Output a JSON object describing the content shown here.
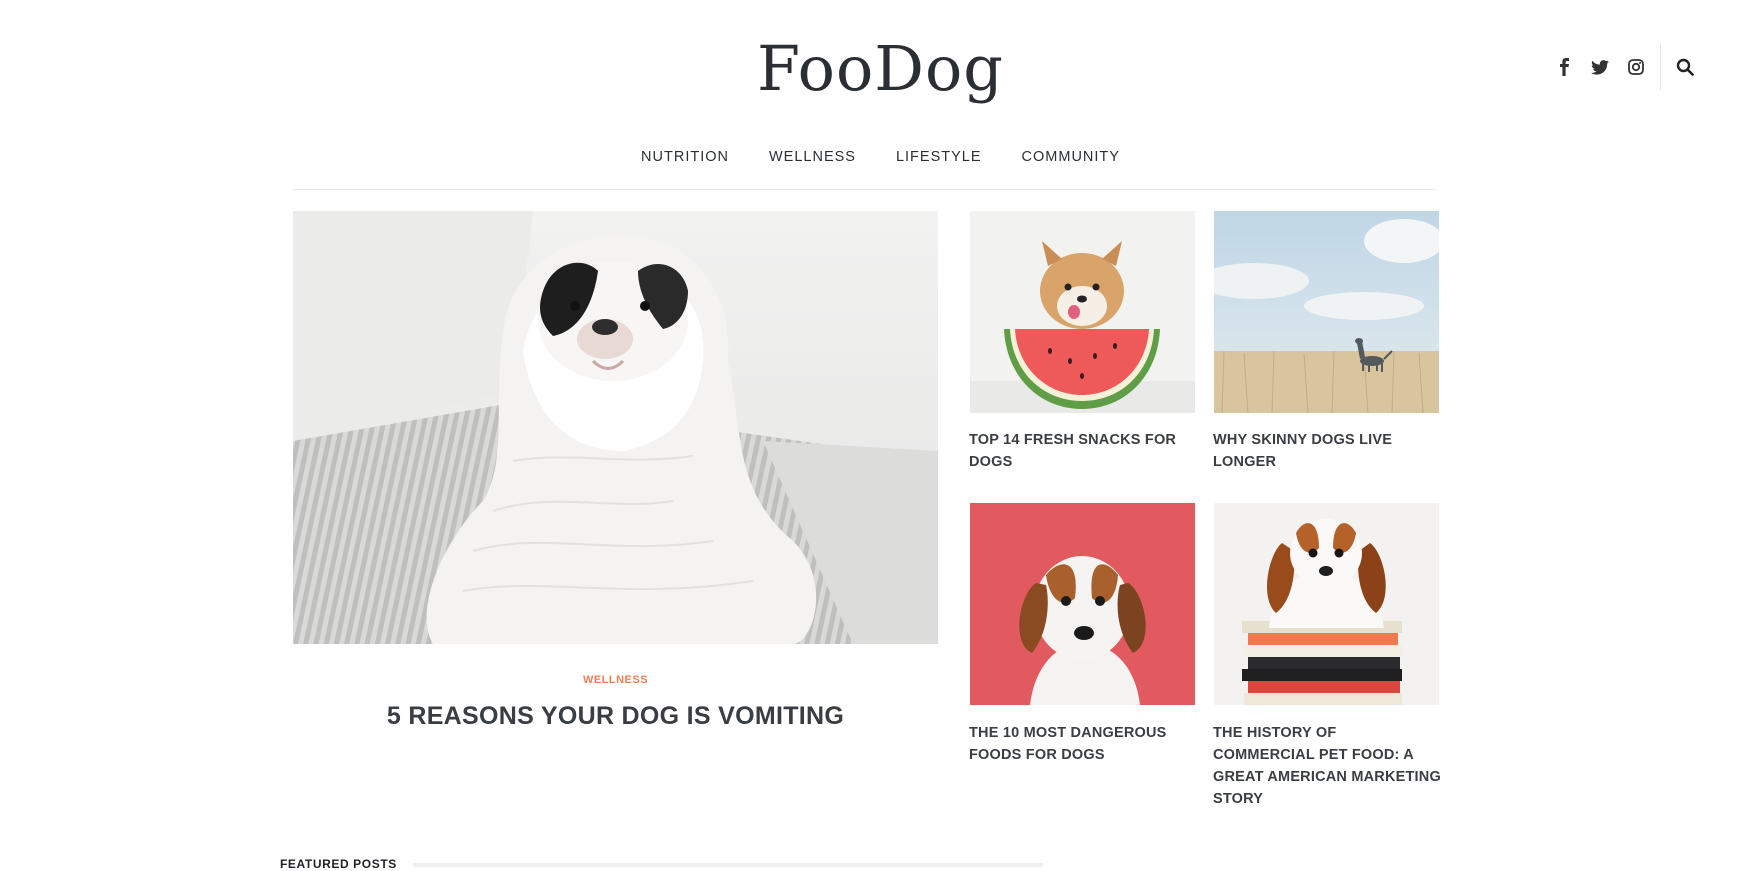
{
  "site": {
    "logo": "FooDog"
  },
  "social": [
    {
      "icon": "facebook-icon",
      "glyph": "f"
    },
    {
      "icon": "twitter-icon",
      "glyph": "t"
    },
    {
      "icon": "instagram-icon",
      "glyph": "◎"
    },
    {
      "icon": "search-icon",
      "glyph": "⚲"
    }
  ],
  "nav": {
    "items": [
      "NUTRITION",
      "WELLNESS",
      "LIFESTYLE",
      "COMMUNITY"
    ]
  },
  "hero": {
    "category": "WELLNESS",
    "title": "5 REASONS YOUR DOG IS VOMITING"
  },
  "cards": [
    {
      "title": "TOP 14 FRESH SNACKS FOR DOGS"
    },
    {
      "title": "WHY SKINNY DOGS LIVE LONGER"
    },
    {
      "title": "THE 10 MOST DANGEROUS FOODS FOR DOGS"
    },
    {
      "title": "THE HISTORY OF COMMERCIAL PET FOOD: A GREAT AMERICAN MARKETING STORY"
    }
  ],
  "featured": {
    "label": "FEATURED POSTS"
  },
  "colors": {
    "accent": "#ef7e55",
    "text": "#3a3e42"
  }
}
